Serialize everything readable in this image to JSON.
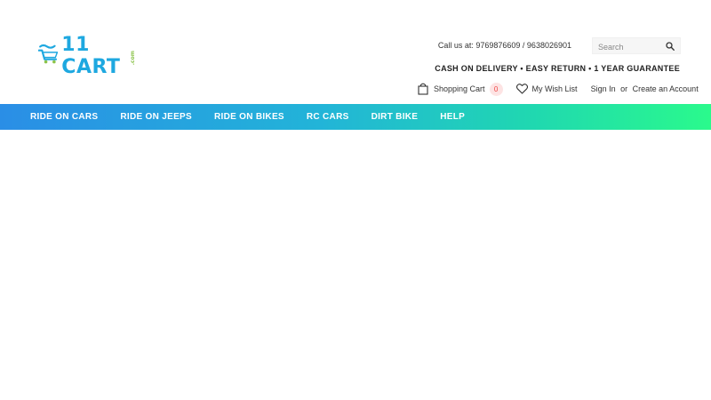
{
  "brand": {
    "logo_text": "11 CART",
    "logo_suffix": ".com"
  },
  "header": {
    "call_us": "Call us at: 9769876609 / 9638026901",
    "promo": "CASH ON DELIVERY • EASY RETURN • 1 YEAR GUARANTEE"
  },
  "search": {
    "placeholder": "Search",
    "value": ""
  },
  "toolbar": {
    "cart_label": "Shopping Cart",
    "cart_count": "0",
    "wishlist_label": "My Wish List",
    "signin_label": "Sign In",
    "or_text": "or",
    "create_account_label": "Create an Account"
  },
  "nav": {
    "items": [
      {
        "label": "RIDE ON CARS"
      },
      {
        "label": "RIDE ON JEEPS"
      },
      {
        "label": "RIDE ON BIKES"
      },
      {
        "label": "RC CARS"
      },
      {
        "label": "DIRT BIKE"
      },
      {
        "label": "HELP"
      }
    ]
  },
  "colors": {
    "brand_blue": "#1ea8e0",
    "brand_green": "#8bc34a",
    "nav_gradient_start": "#2a8ee6",
    "nav_gradient_end": "#2afa8c",
    "cart_badge_bg": "#fde3e3",
    "cart_badge_text": "#e44444"
  }
}
